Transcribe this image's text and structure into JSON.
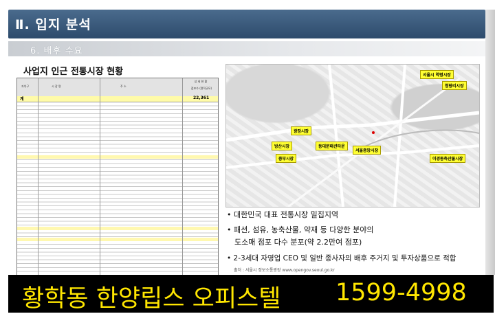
{
  "header": {
    "title": "Ⅱ. 입지 분석"
  },
  "subheader": {
    "title": "6. 배후 수요"
  },
  "table": {
    "title": "사업지 인근 전통시장 현황",
    "headers": [
      "자치구",
      "시 장 명",
      "주 소",
      "점포수 (면적규모)"
    ],
    "section_label": "상 세 현 황",
    "total_label": "계",
    "total_value": "22,361"
  },
  "map": {
    "labels": [
      "서울시 약령시장",
      "청량리시장",
      "광장시장",
      "이경동축산물시장",
      "방산시장",
      "동대문패션타운",
      "서울중앙시장",
      "중부시장"
    ],
    "source": "출처 : 서울시 정보소통광장 www.opengov.seoul.go.kr"
  },
  "bullets": [
    "• 대한민국 대표 전통시장 밀집지역",
    "• 패션, 섬유, 농축산물, 약재 등 다양한 분야의",
    "  도소매 점포 다수 분포(약 2.2만여 점포)",
    "• 2-3세대 자영업 CEO 및 일반 종사자의 배후 주거지 및 투자상품으로 적합"
  ],
  "banner": {
    "text": "황학동 한양립스 오피스텔",
    "phone": "1599-4998"
  }
}
